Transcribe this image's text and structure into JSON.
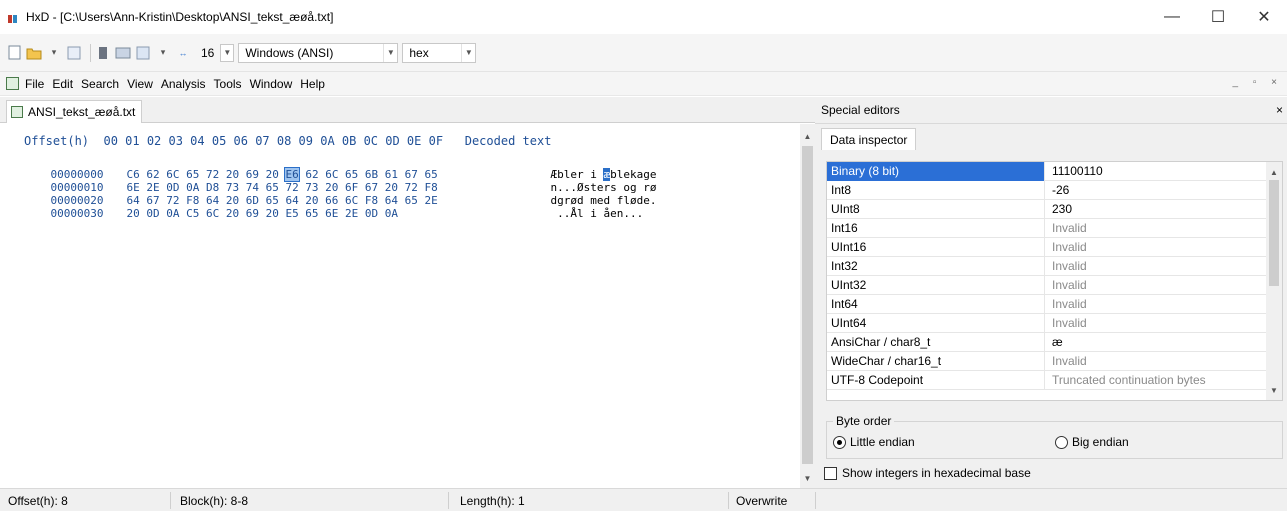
{
  "window": {
    "title": "HxD - [C:\\Users\\Ann-Kristin\\Desktop\\ANSI_tekst_æøå.txt]",
    "minimize": "—",
    "maximize": "☐",
    "close": "✕"
  },
  "toolbar": {
    "bytes_per_row": "16",
    "encoding": "Windows (ANSI)",
    "offset_base": "hex"
  },
  "menu": {
    "items": [
      "File",
      "Edit",
      "Search",
      "View",
      "Analysis",
      "Tools",
      "Window",
      "Help"
    ],
    "mdi_controls": "_ ▫ ×"
  },
  "document": {
    "tab_label": "ANSI_tekst_æøå.txt",
    "header_offset": "Offset(h)",
    "header_columns": "00 01 02 03 04 05 06 07 08 09 0A 0B 0C 0D 0E 0F",
    "header_decoded": "Decoded text",
    "rows": [
      {
        "offset": "00000000",
        "bytes_pre": "C6 62 6C 65 72 20 69 20 ",
        "bytes_sel": "E6",
        "bytes_post": " 62 6C 65 6B 61 67 65",
        "text_pre": "Æbler i ",
        "text_sel": "æ",
        "text_post": "blekage"
      },
      {
        "offset": "00000010",
        "bytes_pre": "6E 2E 0D 0A D8 73 74 65 72 73 20 6F 67 20 72 F8",
        "bytes_sel": "",
        "bytes_post": "",
        "text_pre": "n...Østers og rø",
        "text_sel": "",
        "text_post": ""
      },
      {
        "offset": "00000020",
        "bytes_pre": "64 67 72 F8 64 20 6D 65 64 20 66 6C F8 64 65 2E",
        "bytes_sel": "",
        "bytes_post": "",
        "text_pre": "dgrød med fløde.",
        "text_sel": "",
        "text_post": ""
      },
      {
        "offset": "00000030",
        "bytes_pre": "20 0D 0A C5 6C 20 69 20 E5 65 6E 2E 0D 0A",
        "bytes_sel": "",
        "bytes_post": "",
        "text_pre": " ..Ål i åen...",
        "text_sel": "",
        "text_post": ""
      }
    ]
  },
  "special_editors": {
    "title": "Special editors",
    "close": "×",
    "tab": "Data inspector",
    "rows": [
      {
        "name": "Binary (8 bit)",
        "value": "11100110",
        "invalid": false,
        "selected": true
      },
      {
        "name": "Int8",
        "value": "-26",
        "invalid": false,
        "selected": false
      },
      {
        "name": "UInt8",
        "value": "230",
        "invalid": false,
        "selected": false
      },
      {
        "name": "Int16",
        "value": "Invalid",
        "invalid": true,
        "selected": false
      },
      {
        "name": "UInt16",
        "value": "Invalid",
        "invalid": true,
        "selected": false
      },
      {
        "name": "Int32",
        "value": "Invalid",
        "invalid": true,
        "selected": false
      },
      {
        "name": "UInt32",
        "value": "Invalid",
        "invalid": true,
        "selected": false
      },
      {
        "name": "Int64",
        "value": "Invalid",
        "invalid": true,
        "selected": false
      },
      {
        "name": "UInt64",
        "value": "Invalid",
        "invalid": true,
        "selected": false
      },
      {
        "name": "AnsiChar / char8_t",
        "value": "æ",
        "invalid": false,
        "selected": false
      },
      {
        "name": "WideChar / char16_t",
        "value": "Invalid",
        "invalid": true,
        "selected": false
      },
      {
        "name": "UTF-8 Codepoint",
        "value": "Truncated continuation bytes",
        "invalid": true,
        "selected": false
      }
    ],
    "byte_order_label": "Byte order",
    "little_endian": "Little endian",
    "big_endian": "Big endian",
    "little_endian_checked": true,
    "hex_checkbox_label": "Show integers in hexadecimal base"
  },
  "status": {
    "offset": "Offset(h): 8",
    "block": "Block(h): 8-8",
    "length": "Length(h): 1",
    "mode": "Overwrite"
  }
}
